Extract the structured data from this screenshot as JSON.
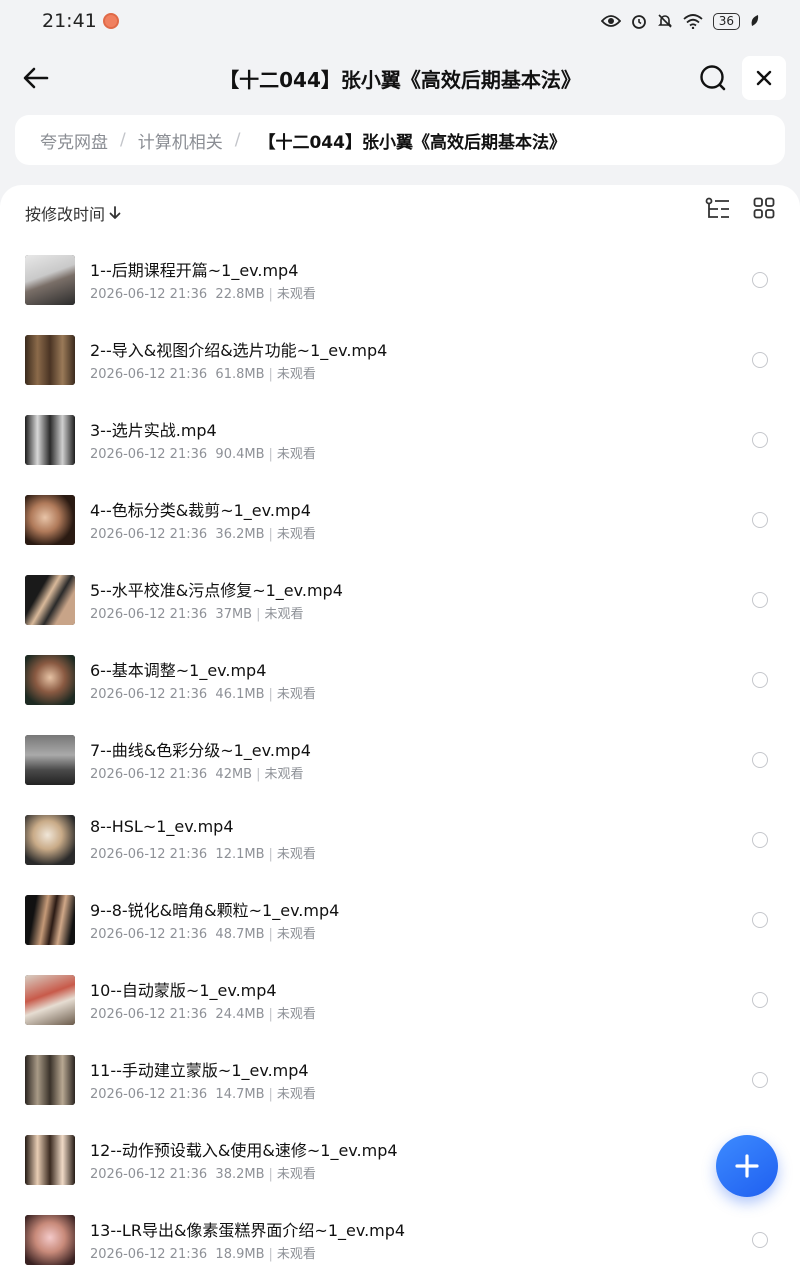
{
  "status_bar": {
    "time": "21:41",
    "battery": "36"
  },
  "header": {
    "title": "【十二044】张小翼《高效后期基本法》"
  },
  "breadcrumb": {
    "items": [
      "夸克网盘",
      "计算机相关"
    ],
    "current": "【十二044】张小翼《高效后期基本法》"
  },
  "toolbar": {
    "sort_label": "按修改时间"
  },
  "files": [
    {
      "name": "1--后期课程开篇~1_ev.mp4",
      "date": "2026-06-12 21:36",
      "size": "22.8MB",
      "status": "未观看"
    },
    {
      "name": "2--导入&视图介绍&选片功能~1_ev.mp4",
      "date": "2026-06-12 21:36",
      "size": "61.8MB",
      "status": "未观看"
    },
    {
      "name": "3--选片实战.mp4",
      "date": "2026-06-12 21:36",
      "size": "90.4MB",
      "status": "未观看"
    },
    {
      "name": "4--色标分类&裁剪~1_ev.mp4",
      "date": "2026-06-12 21:36",
      "size": "36.2MB",
      "status": "未观看"
    },
    {
      "name": "5--水平校准&污点修复~1_ev.mp4",
      "date": "2026-06-12 21:36",
      "size": "37MB",
      "status": "未观看"
    },
    {
      "name": "6--基本调整~1_ev.mp4",
      "date": "2026-06-12 21:36",
      "size": "46.1MB",
      "status": "未观看"
    },
    {
      "name": "7--曲线&色彩分级~1_ev.mp4",
      "date": "2026-06-12 21:36",
      "size": "42MB",
      "status": "未观看"
    },
    {
      "name": "8--HSL~1_ev.mp4",
      "date": "2026-06-12 21:36",
      "size": "12.1MB",
      "status": "未观看"
    },
    {
      "name": "9--8-锐化&暗角&颗粒~1_ev.mp4",
      "date": "2026-06-12 21:36",
      "size": "48.7MB",
      "status": "未观看"
    },
    {
      "name": "10--自动蒙版~1_ev.mp4",
      "date": "2026-06-12 21:36",
      "size": "24.4MB",
      "status": "未观看"
    },
    {
      "name": "11--手动建立蒙版~1_ev.mp4",
      "date": "2026-06-12 21:36",
      "size": "14.7MB",
      "status": "未观看"
    },
    {
      "name": "12--动作预设载入&使用&速修~1_ev.mp4",
      "date": "2026-06-12 21:36",
      "size": "38.2MB",
      "status": "未观看"
    },
    {
      "name": "13--LR导出&像素蛋糕界面介绍~1_ev.mp4",
      "date": "2026-06-12 21:36",
      "size": "18.9MB",
      "status": "未观看"
    }
  ],
  "colors": {
    "accent": "#2563f0",
    "background": "#f2f3f5"
  }
}
